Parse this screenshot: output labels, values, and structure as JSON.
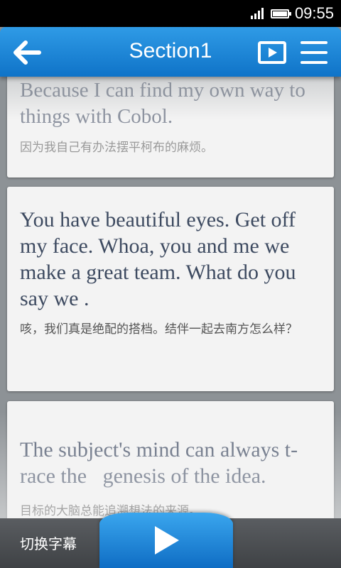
{
  "status_bar": {
    "time": "09:55",
    "battery_level": 0.9,
    "signal_bars": 4
  },
  "header": {
    "title": "Section1",
    "back_icon": "arrow-left-icon",
    "video_icon": "play-video-icon",
    "menu_icon": "hamburger-menu-icon",
    "accent_color": "#1a82d6"
  },
  "cards": [
    {
      "en": "Because I can find my own way to things with Cobol.",
      "zh": "因为我自己有办法摆平柯布的麻烦。"
    },
    {
      "en": "You have beautiful eyes. Get off my face. Whoa, you and me we make a great team. What do you say we .",
      "zh": "咳，我们真是绝配的搭档。结伴一起去南方怎么样？"
    },
    {
      "en": "The subject's mind can always t-race the   genesis of the idea.",
      "zh": "目标的大脑总能追溯想法的来源。"
    }
  ],
  "bottom_bar": {
    "switch_subtitle_label": "切换字幕",
    "play_icon": "play-icon"
  }
}
